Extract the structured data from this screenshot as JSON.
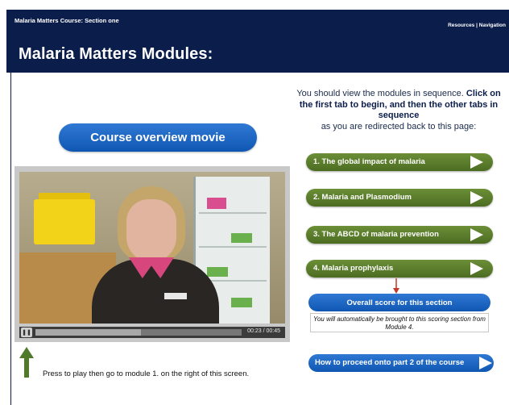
{
  "header": {
    "course_label": "Malaria Matters Course: Section one",
    "resources_link": "Resources",
    "separator": "|",
    "navigation_link": "Navigation",
    "title": "Malaria Matters Modules:"
  },
  "movie": {
    "button_label": "Course overview movie",
    "time_readout": "00:23 / 00:45",
    "progress_percent": 51,
    "play_icon": "pause-icon"
  },
  "press_instruction": "Press to play then go to module 1. on the right of this screen.",
  "instructions": {
    "part1": "You should view the modules in sequence.",
    "part2": "Click on the first tab to begin, and then the other tabs in sequence",
    "part3": "as you are redirected back to this page:"
  },
  "modules": [
    {
      "label": "1. The global impact of malaria"
    },
    {
      "label": "2. Malaria and Plasmodium"
    },
    {
      "label": "3. The ABCD of malaria prevention"
    },
    {
      "label": "4. Malaria prophylaxis"
    }
  ],
  "score": {
    "button_label": "Overall score for this section",
    "note": "You will automatically be brought to this scoring section from Module 4."
  },
  "proceed": {
    "button_label": "How to proceed onto part 2 of the course"
  },
  "colors": {
    "header_bg": "#0b1d4a",
    "module_green": "#5a7d2a",
    "action_blue": "#1565c0",
    "arrow_green": "#4e7a2a",
    "arrow_red": "#c0392b"
  }
}
